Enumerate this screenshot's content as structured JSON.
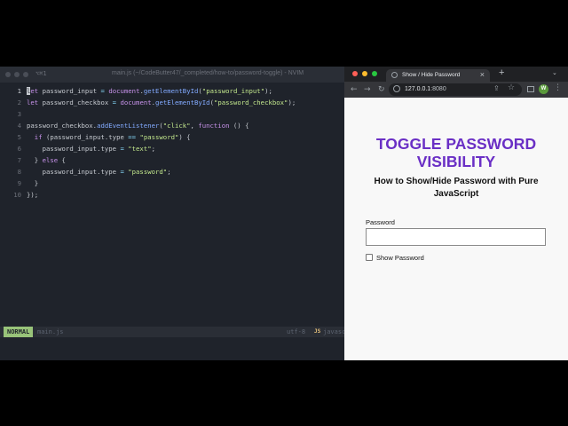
{
  "editor": {
    "title_shortcut": "⌥⌘1",
    "title": "main.js (~/CodeButter47/_completed/how-to/password-toggle) - NVIM",
    "lines": [
      {
        "num": "1",
        "segs": [
          {
            "t": "l",
            "c": "cursor-ch"
          },
          {
            "t": "et",
            "c": "kw"
          },
          {
            "t": " password_input "
          },
          {
            "t": "=",
            "c": "op"
          },
          {
            "t": " "
          },
          {
            "t": "document",
            "c": "kw"
          },
          {
            "t": "."
          },
          {
            "t": "getElementById",
            "c": "fn"
          },
          {
            "t": "("
          },
          {
            "t": "\"password_input\"",
            "c": "str"
          },
          {
            "t": ");"
          }
        ]
      },
      {
        "num": "2",
        "segs": [
          {
            "t": "let",
            "c": "kw"
          },
          {
            "t": " password_checkbox "
          },
          {
            "t": "=",
            "c": "op"
          },
          {
            "t": " "
          },
          {
            "t": "document",
            "c": "kw"
          },
          {
            "t": "."
          },
          {
            "t": "getElementById",
            "c": "fn"
          },
          {
            "t": "("
          },
          {
            "t": "\"password_checkbox\"",
            "c": "str"
          },
          {
            "t": ");"
          }
        ]
      },
      {
        "num": "3",
        "segs": []
      },
      {
        "num": "4",
        "segs": [
          {
            "t": "password_checkbox."
          },
          {
            "t": "addEventListener",
            "c": "fn"
          },
          {
            "t": "("
          },
          {
            "t": "\"click\"",
            "c": "str"
          },
          {
            "t": ", "
          },
          {
            "t": "function",
            "c": "kw"
          },
          {
            "t": " () {"
          }
        ]
      },
      {
        "num": "5",
        "segs": [
          {
            "t": "  "
          },
          {
            "t": "if",
            "c": "kw"
          },
          {
            "t": " (password_input.type "
          },
          {
            "t": "==",
            "c": "op"
          },
          {
            "t": " "
          },
          {
            "t": "\"password\"",
            "c": "str"
          },
          {
            "t": ") {"
          }
        ]
      },
      {
        "num": "6",
        "segs": [
          {
            "t": "    password_input.type "
          },
          {
            "t": "=",
            "c": "op"
          },
          {
            "t": " "
          },
          {
            "t": "\"text\"",
            "c": "str"
          },
          {
            "t": ";"
          }
        ]
      },
      {
        "num": "7",
        "segs": [
          {
            "t": "  } "
          },
          {
            "t": "else",
            "c": "kw"
          },
          {
            "t": " {"
          }
        ]
      },
      {
        "num": "8",
        "segs": [
          {
            "t": "    password_input.type "
          },
          {
            "t": "=",
            "c": "op"
          },
          {
            "t": " "
          },
          {
            "t": "\"password\"",
            "c": "str"
          },
          {
            "t": ";"
          }
        ]
      },
      {
        "num": "9",
        "segs": [
          {
            "t": "  }"
          }
        ]
      },
      {
        "num": "10",
        "segs": [
          {
            "t": "});"
          }
        ]
      }
    ],
    "status": {
      "mode": "NORMAL",
      "file": "main.js",
      "encoding": "utf-8",
      "filetype_icon": "JS",
      "filetype": "javascript"
    }
  },
  "browser": {
    "tab_title": "Show / Hide Password",
    "tab_close": "×",
    "new_tab": "+",
    "tab_menu": "⌄",
    "url_host": "127.0.0.1",
    "url_port": ":8080",
    "profile_initial": "W",
    "page": {
      "title_line1": "TOGGLE PASSWORD",
      "title_line2": "VISIBILITY",
      "subtitle": "How to Show/Hide Password with Pure JavaScript",
      "password_label": "Password",
      "password_value": "",
      "checkbox_label": "Show Password",
      "checkbox_checked": false
    }
  },
  "colors": {
    "accent_title": "#6a2fc5",
    "mode_bg": "#98c379",
    "traffic_red": "#ff5f57",
    "traffic_yellow": "#febc2e",
    "traffic_green": "#28c840",
    "editor_bg": "#1f232b"
  },
  "icons": [
    "back-arrow-icon",
    "forward-arrow-icon",
    "reload-icon",
    "site-info-icon",
    "share-icon",
    "star-icon",
    "side-panel-icon",
    "kebab-menu-icon",
    "globe-icon",
    "close-icon"
  ]
}
